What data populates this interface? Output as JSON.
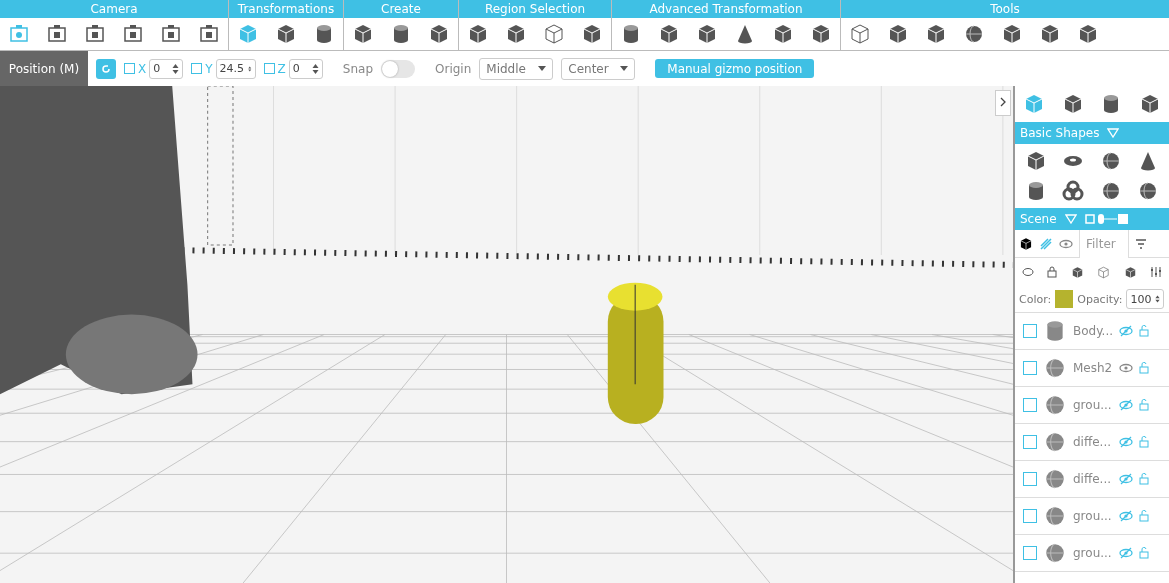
{
  "toolbar": [
    {
      "title": "Camera",
      "tools": [
        {
          "kind": "camera360",
          "selected": true
        },
        {
          "kind": "camera",
          "selected": false
        },
        {
          "kind": "camera",
          "selected": false
        },
        {
          "kind": "camera",
          "selected": false
        },
        {
          "kind": "camera",
          "selected": false
        },
        {
          "kind": "camera",
          "selected": false
        }
      ]
    },
    {
      "title": "Transformations",
      "tools": [
        {
          "kind": "cube",
          "selected": true
        },
        {
          "kind": "cube",
          "selected": false
        },
        {
          "kind": "cylinder",
          "selected": false
        }
      ]
    },
    {
      "title": "Create",
      "tools": [
        {
          "kind": "cube",
          "selected": false
        },
        {
          "kind": "cylinder",
          "selected": false
        },
        {
          "kind": "cube",
          "selected": false
        }
      ]
    },
    {
      "title": "Region Selection",
      "tools": [
        {
          "kind": "cube",
          "selected": false
        },
        {
          "kind": "cube",
          "selected": false
        },
        {
          "kind": "wire",
          "selected": false
        },
        {
          "kind": "cube",
          "selected": false
        }
      ]
    },
    {
      "title": "Advanced Transformation",
      "tools": [
        {
          "kind": "cylinder",
          "selected": false
        },
        {
          "kind": "cube",
          "selected": false
        },
        {
          "kind": "cube",
          "selected": false
        },
        {
          "kind": "cone",
          "selected": false
        },
        {
          "kind": "cube",
          "selected": false
        },
        {
          "kind": "cube",
          "selected": false
        }
      ]
    },
    {
      "title": "Tools",
      "tools": [
        {
          "kind": "wire",
          "selected": false
        },
        {
          "kind": "cube",
          "selected": false
        },
        {
          "kind": "cube",
          "selected": false
        },
        {
          "kind": "sphere",
          "selected": false
        },
        {
          "kind": "cube",
          "selected": false
        },
        {
          "kind": "cube",
          "selected": false
        },
        {
          "kind": "cube",
          "selected": false
        }
      ]
    }
  ],
  "position_bar": {
    "label": "Position (M)",
    "axes": [
      {
        "name": "X",
        "checked": false,
        "value": "0"
      },
      {
        "name": "Y",
        "checked": false,
        "value": "24.5"
      },
      {
        "name": "Z",
        "checked": false,
        "value": "0"
      }
    ],
    "snap": {
      "label": "Snap",
      "on": false
    },
    "origin": {
      "label": "Origin",
      "selects": [
        "Middle",
        "Center"
      ]
    },
    "button": "Manual gizmo position"
  },
  "sidebar": {
    "top_tools": [
      {
        "kind": "cube",
        "selected": true
      },
      {
        "kind": "cube",
        "selected": false
      },
      {
        "kind": "cylinder",
        "selected": false
      },
      {
        "kind": "cube",
        "selected": false
      }
    ],
    "basic_shapes": {
      "title": "Basic Shapes",
      "shapes": [
        {
          "kind": "cube"
        },
        {
          "kind": "torus"
        },
        {
          "kind": "sphere"
        },
        {
          "kind": "cone"
        },
        {
          "kind": "cylinder"
        },
        {
          "kind": "knot"
        },
        {
          "kind": "sphere"
        },
        {
          "kind": "sphere"
        }
      ]
    },
    "scene": {
      "title": "Scene",
      "filter_placeholder": "Filter",
      "color_label": "Color:",
      "color": "#b5b32e",
      "opacity_label": "Opacity:",
      "opacity": "100",
      "items": [
        {
          "name": "Body...",
          "checked": false,
          "hidden": true
        },
        {
          "name": "Mesh2",
          "checked": false,
          "hidden": false
        },
        {
          "name": "grou...",
          "checked": false,
          "hidden": true
        },
        {
          "name": "diffe...",
          "checked": false,
          "hidden": true
        },
        {
          "name": "diffe...",
          "checked": false,
          "hidden": true
        },
        {
          "name": "grou...",
          "checked": false,
          "hidden": true
        },
        {
          "name": "grou...",
          "checked": false,
          "hidden": true
        }
      ]
    }
  }
}
